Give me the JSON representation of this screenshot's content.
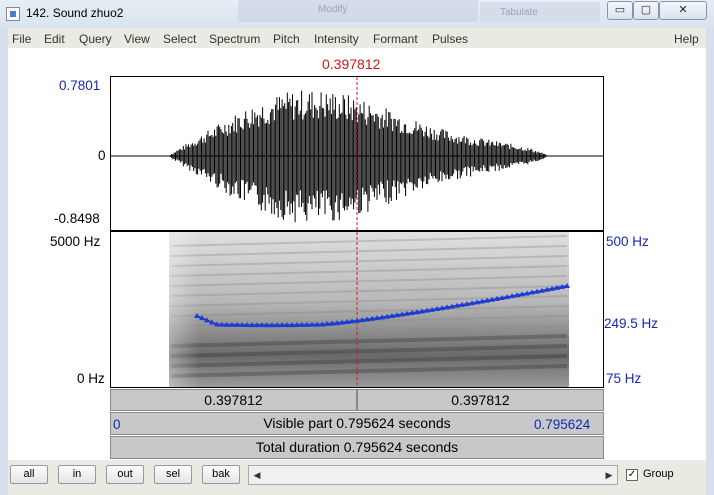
{
  "window": {
    "title": "142. Sound zhuo2",
    "controls": {
      "minimize": "▭",
      "maximize": "▢",
      "close": "✕"
    },
    "background_hints": [
      "Modify",
      "Tabulate"
    ]
  },
  "menu": {
    "items": [
      "File",
      "Edit",
      "Query",
      "View",
      "Select",
      "Spectrum",
      "Pitch",
      "Intensity",
      "Formant",
      "Pulses"
    ],
    "help": "Help"
  },
  "waveform": {
    "cursor_time": "0.397812",
    "y_max_label": "0.7801",
    "y_zero_label": "0",
    "y_min_label": "-0.8498"
  },
  "spectrogram": {
    "freq_max_label": "5000 Hz",
    "freq_min_label": "0 Hz",
    "pitch_max_label": "500 Hz",
    "pitch_mid_label": "249.5 Hz",
    "pitch_min_label": "75 Hz"
  },
  "time_bars": {
    "left_segment": "0.397812",
    "right_segment": "0.397812",
    "visible_start": "0",
    "visible_text": "Visible part 0.795624 seconds",
    "visible_end": "0.795624",
    "total_text": "Total duration 0.795624 seconds"
  },
  "bottom": {
    "buttons": [
      "all",
      "in",
      "out",
      "sel",
      "bak"
    ],
    "group_label": "Group",
    "group_checked": true,
    "check_glyph": "✓",
    "scroll_left": "◀",
    "scroll_right": "▶"
  },
  "colors": {
    "cursor": "#d01818",
    "pitch_track": "#1e3cd2",
    "axis_blue": "#1428b4"
  }
}
